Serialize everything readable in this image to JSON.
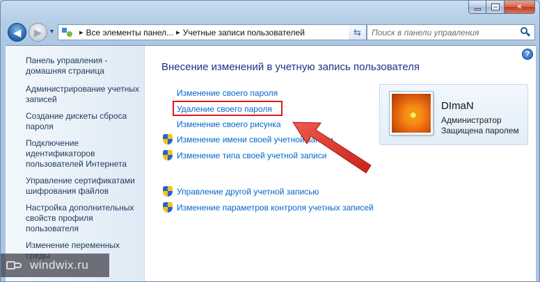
{
  "window": {
    "caption": {
      "minimize": "",
      "maximize": "",
      "close": "✕"
    }
  },
  "address_bar": {
    "segments": [
      "Все элементы панел...",
      "Учетные записи пользователей"
    ],
    "separator": "▸"
  },
  "search": {
    "placeholder": "Поиск в панели управления"
  },
  "sidebar": {
    "items": [
      {
        "label": "Панель управления - домашняя страница"
      },
      {
        "label": "Администрирование учетных записей"
      },
      {
        "label": "Создание дискеты сброса пароля"
      },
      {
        "label": "Подключение идентификаторов пользователей Интернета"
      },
      {
        "label": "Управление сертификатами шифрования файлов"
      },
      {
        "label": "Настройка дополнительных свойств профиля пользователя"
      },
      {
        "label": "Изменение переменных среды"
      }
    ]
  },
  "main": {
    "title": "Внесение изменений в учетную запись пользователя",
    "tasks": [
      {
        "label": "Изменение своего пароля",
        "shield": false
      },
      {
        "label": "Удаление своего пароля",
        "shield": false,
        "highlighted": true
      },
      {
        "label": "Изменение своего рисунка",
        "shield": false
      },
      {
        "label": "Изменение имени своей учетной записи",
        "shield": true
      },
      {
        "label": "Изменение типа своей учетной записи",
        "shield": true
      }
    ],
    "other_tasks": [
      {
        "label": "Управление другой учетной записью",
        "shield": true
      },
      {
        "label": "Изменение параметров контроля учетных записей",
        "shield": true
      }
    ]
  },
  "user": {
    "name": "DImaN",
    "role": "Администратор",
    "status": "Защищена паролем"
  },
  "help": {
    "label": "?"
  },
  "watermark": {
    "text": "windwix.ru"
  },
  "colors": {
    "link": "#0066cc",
    "title": "#1e3287",
    "sidebar_link": "#1e395b",
    "highlight": "#e0161a",
    "arrow": "#e0302a"
  }
}
